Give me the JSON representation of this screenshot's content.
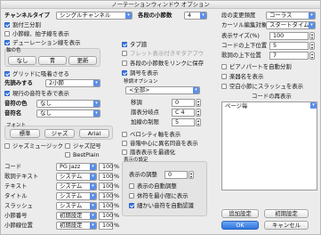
{
  "window": {
    "title": "ノーテーションウィンドウ オプション"
  },
  "left": {
    "channel_type_label": "チャンネルタイプ",
    "channel_type_value": "シングルチャンネル",
    "chk_3_split": "割付三分割",
    "chk_rest_dot": "小節線、拍子線を表示",
    "chk_duration": "デューレーション線を表示",
    "pitch_axis_label": "軸の色",
    "pitch_axis_options": [
      "なし",
      "青",
      "更新"
    ],
    "chk_grid": "グリッドに吸着させる",
    "quantize_label": "先読みする",
    "quantize_value": "2小節",
    "chk_current_note": "現行の音符を赤で表示",
    "note_color_label": "音符の色",
    "note_color_value": "なし",
    "note_name_label": "音符名",
    "note_name_value": "なし",
    "font_label": "フォント",
    "font_buttons": [
      "標準",
      "ジャズ",
      "Arial"
    ],
    "chk_jazz_music": "ジャズミュージック",
    "chk_jazz_symbol": "ジャズ記号",
    "chk_bestplain": "BestPlain",
    "fonts_rows": [
      {
        "label": "コード",
        "font": "PG Jazz",
        "size": "100"
      },
      {
        "label": "歌詞テキスト",
        "font": "システム",
        "size": "100"
      },
      {
        "label": "テキスト",
        "font": "システム",
        "size": "100"
      },
      {
        "label": "タイトル",
        "font": "システム",
        "size": "100"
      },
      {
        "label": "スラッシュ",
        "font": "システム",
        "size": "100"
      },
      {
        "label": "小節番号",
        "font": "初期設定",
        "size": "100"
      },
      {
        "label": "小節線位置",
        "font": "初期設定",
        "size": "100"
      }
    ],
    "percent": "%"
  },
  "middle": {
    "measure_label": "各段の小節数",
    "measure_value": "4",
    "chk_tab": "タブ譜",
    "chk_fret_guitar": "フレット表示付きギタアブウ",
    "chk_sync_measures": "各段の小節数をリンクに保存",
    "chk_key_change": "調号を表示",
    "key_option_label": "移調オプション",
    "key_option_value": "<全部>",
    "transpose_label": "移調",
    "transpose_value": "0",
    "split_label": "譜表分岐点",
    "split_value": "C 4",
    "add_key_label": "加線の制限",
    "add_key_value": "5",
    "chk_velocity": "ベロシティ軸を表示",
    "chk_pitch_center": "音階中心に異名同音を表示",
    "chk_optimize": "譜表表示を最適化",
    "display_range_label": "表示の設定",
    "display_adjust_label": "表示の調整",
    "display_adjust_value": "0",
    "chk_auto_adjust": "表示の自動調整",
    "chk_show_rest": "休符を最小限に表示",
    "chk_fine_notes": "細かい音符を自動認識"
  },
  "right": {
    "refresh_label": "段の変更頻度",
    "refresh_value": "コーラス",
    "cursor_label": "カーソル編集対象",
    "cursor_value": "スタートタイム",
    "display_size_label": "表示サイズ(%)",
    "display_size_value": "100",
    "chord_pos_label": "コードの上下位置",
    "chord_pos_value": "5",
    "lyric_pos_label": "歌詞の上下位置",
    "lyric_pos_value": "7",
    "chk_piano_auto": "ピアノパートを自動分割",
    "chk_chord_names": "楽器名を表示",
    "chk_slash_chord": "空白小節にスラッシュを表示",
    "chord_display_label": "コードの再表示",
    "chord_display_items": [
      "ページ毎"
    ],
    "btn_extra": "追加設定",
    "btn_default": "初期設定",
    "btn_ok": "OK",
    "btn_cancel": "キャンセル"
  }
}
